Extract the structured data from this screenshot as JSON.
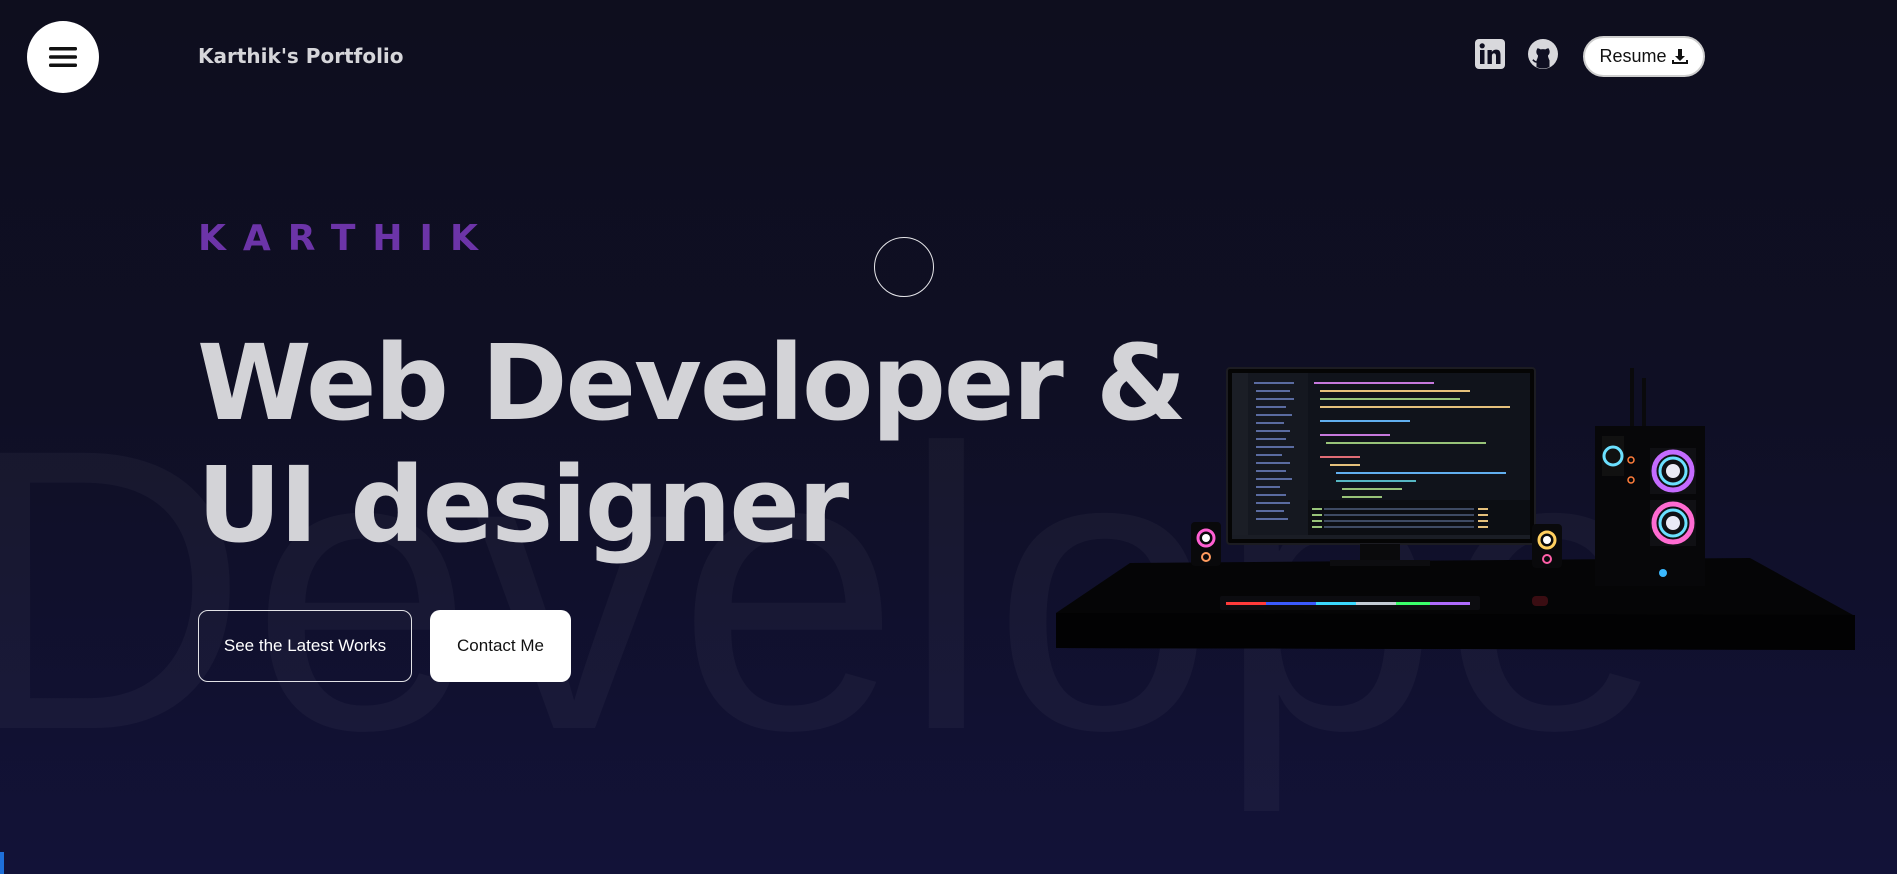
{
  "background_word": "Develope",
  "header": {
    "menu_icon": "hamburger-menu-icon",
    "brand": "Karthik's Portfolio",
    "social": [
      {
        "name": "linkedin-icon"
      },
      {
        "name": "github-icon"
      }
    ],
    "resume_label": "Resume",
    "resume_icon": "download-icon"
  },
  "hero": {
    "eyebrow": "KARTHIK",
    "headline_line1": "Web Developer &",
    "headline_line2": "UI designer",
    "primary_cta": "See the Latest Works",
    "secondary_cta": "Contact Me"
  },
  "colors": {
    "background": "#0f0f24",
    "accent": "#6c34a8",
    "headline": "#d3d3d7"
  }
}
